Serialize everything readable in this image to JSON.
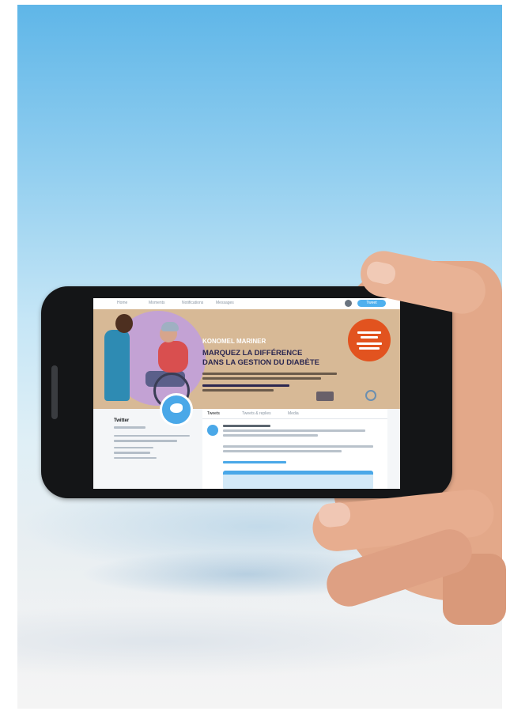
{
  "photo": {
    "description_icon": "hand-holding-phone",
    "sky_color": "#8fcdef",
    "phone_color": "#141517"
  },
  "screen": {
    "nav": {
      "items": [
        "Home",
        "Moments",
        "Notifications",
        "Messages"
      ],
      "tweet_button": "Tweet"
    },
    "banner": {
      "line1": "KONOMEL MARINER",
      "line2": "MARQUEZ LA DIFFÉRENCE",
      "line3": "DANS LA GESTION DU DIABÈTE",
      "accent_color": "#e2531f",
      "headline_color": "#2b2750"
    },
    "profile": {
      "name": "Twitter"
    },
    "tabs": [
      "Tweets",
      "Tweets & replies",
      "Media"
    ],
    "brand_color": "#4aa8e8"
  }
}
